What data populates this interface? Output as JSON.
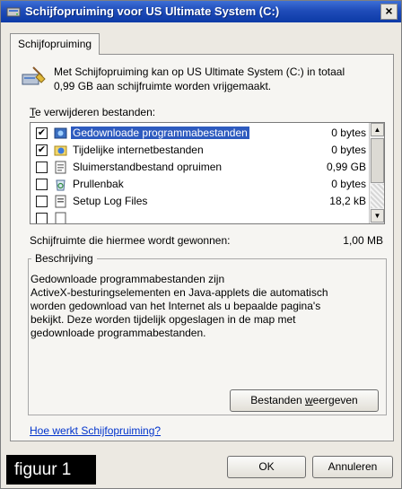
{
  "window": {
    "title": "Schijfopruiming voor US Ultimate System (C:)",
    "close_glyph": "×"
  },
  "tab": {
    "label": "Schijfopruiming"
  },
  "intro": {
    "line1": "Met Schijfopruiming kan op US Ultimate System (C:) in totaal",
    "line2": "0,99 GB aan schijfruimte worden vrijgemaakt."
  },
  "list": {
    "label_prefix": "T",
    "label_rest": "e verwijderen bestanden:",
    "items": [
      {
        "name": "Gedownloade programmabestanden",
        "size": "0 bytes",
        "checked": true,
        "selected": true,
        "icon": "downloaded-programs-icon",
        "check_glyph": "✔"
      },
      {
        "name": "Tijdelijke internetbestanden",
        "size": "0 bytes",
        "checked": true,
        "selected": false,
        "icon": "internet-files-icon",
        "check_glyph": "✔"
      },
      {
        "name": "Sluimerstandbestand opruimen",
        "size": "0,99 GB",
        "checked": false,
        "selected": false,
        "icon": "hibernation-file-icon",
        "check_glyph": ""
      },
      {
        "name": "Prullenbak",
        "size": "0 bytes",
        "checked": false,
        "selected": false,
        "icon": "recycle-bin-icon",
        "check_glyph": ""
      },
      {
        "name": "Setup Log Files",
        "size": "18,2 kB",
        "checked": false,
        "selected": false,
        "icon": "log-file-icon",
        "check_glyph": ""
      }
    ],
    "scroll_up_glyph": "▲",
    "scroll_down_glyph": "▼"
  },
  "gain": {
    "label": "Schijfruimte die hiermee wordt gewonnen:",
    "value": "1,00 MB"
  },
  "description": {
    "title": "Beschrijving",
    "line1": "Gedownloade programmabestanden zijn",
    "line2": "ActiveX-besturingselementen en Java-applets die automatisch",
    "line3": "worden gedownload van het Internet als u bepaalde pagina's",
    "line4": "bekijkt. Deze worden tijdelijk opgeslagen in de map met",
    "line5": "gedownloade programmabestanden."
  },
  "buttons": {
    "view_prefix": "Bestanden ",
    "view_accel": "w",
    "view_rest": "eergeven",
    "ok": "OK",
    "cancel": "Annuleren"
  },
  "help_link": "Hoe werkt Schijfopruiming?",
  "caption_badge": "figuur 1",
  "colors": {
    "titlebar": "#1f4cb9",
    "selection": "#2e5bbf",
    "link": "#0033cc"
  }
}
